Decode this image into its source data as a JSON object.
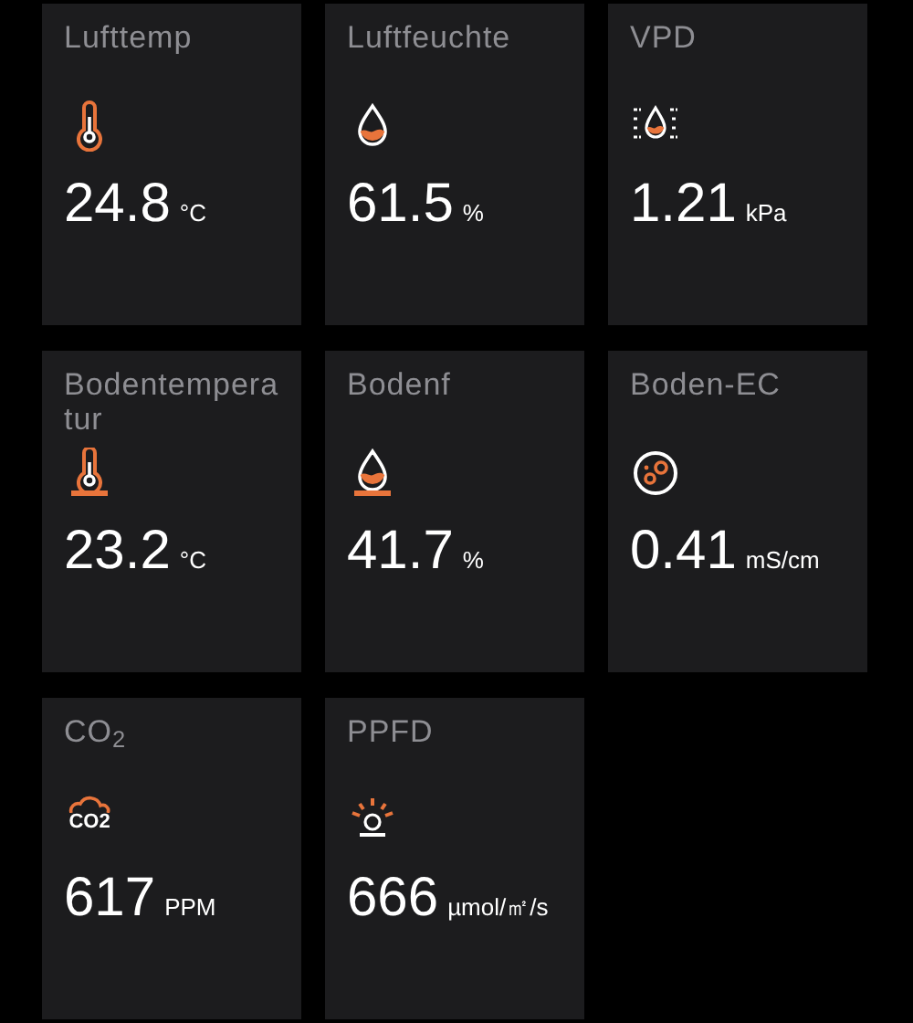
{
  "sensors": [
    {
      "kind": "air-temp",
      "title": "Lufttemp",
      "value": "24.8",
      "unit": "°C"
    },
    {
      "kind": "humidity",
      "title": "Luftfeuchte",
      "value": "61.5",
      "unit": "%"
    },
    {
      "kind": "vpd",
      "title": "VPD",
      "value": "1.21",
      "unit": "kPa"
    },
    {
      "kind": "soil-temp",
      "title": "Bodentemperatur",
      "value": "23.2",
      "unit": "°C"
    },
    {
      "kind": "soil-moisture",
      "title": "Bodenf",
      "value": "41.7",
      "unit": "%"
    },
    {
      "kind": "soil-ec",
      "title": "Boden-EC",
      "value": "0.41",
      "unit": "mS/cm"
    },
    {
      "kind": "co2",
      "title": "CO$_{2}$",
      "icon_label": "CO2",
      "value": "617",
      "unit": "PPM"
    },
    {
      "kind": "light",
      "title": "PPFD",
      "value": "666",
      "unit": "µmol/㎡/s"
    }
  ]
}
